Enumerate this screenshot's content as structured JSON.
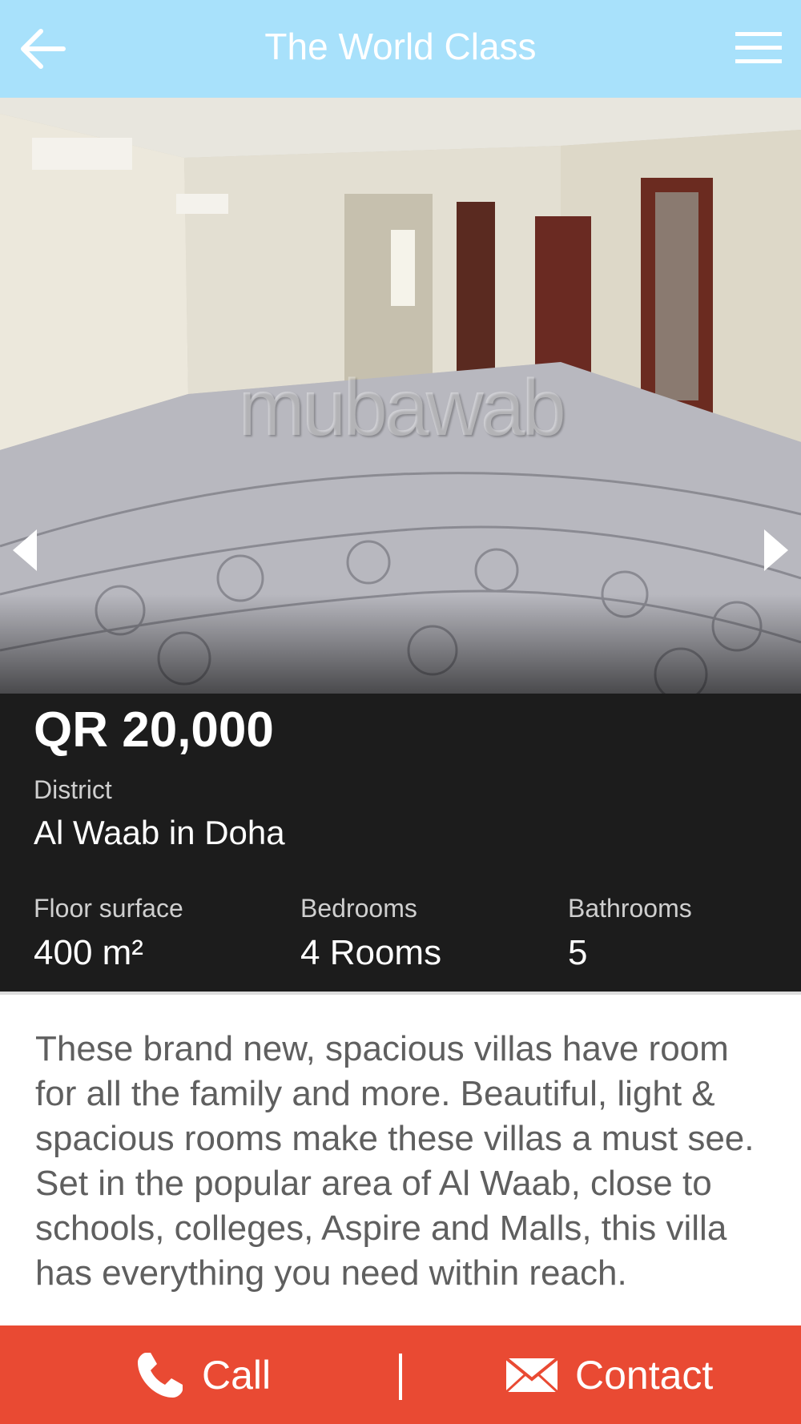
{
  "header": {
    "title": "The World Class",
    "back_icon": "arrow-left-icon",
    "menu_icon": "hamburger-menu-icon",
    "background": "#a8e1fb"
  },
  "gallery": {
    "watermark": "mubawab",
    "prev_icon": "chevron-left-icon",
    "next_icon": "chevron-right-icon"
  },
  "listing": {
    "price": "QR 20,000",
    "district_label": "District",
    "district_value": "Al Waab in Doha",
    "stats": {
      "floor_label": "Floor surface",
      "floor_value": "400 m²",
      "bedrooms_label": "Bedrooms",
      "bedrooms_value": "4 Rooms",
      "bathrooms_label": "Bathrooms",
      "bathrooms_value": "5"
    },
    "description": "These brand new, spacious villas have room for all the family and more. Beautiful, light & spacious rooms make these villas a must see. Set in the popular area of Al Waab, close to schools, colleges, Aspire and Malls, this villa has everything you need within reach."
  },
  "actions": {
    "call_label": "Call",
    "call_icon": "phone-icon",
    "contact_label": "Contact",
    "contact_icon": "envelope-icon",
    "background": "#e94a33"
  }
}
